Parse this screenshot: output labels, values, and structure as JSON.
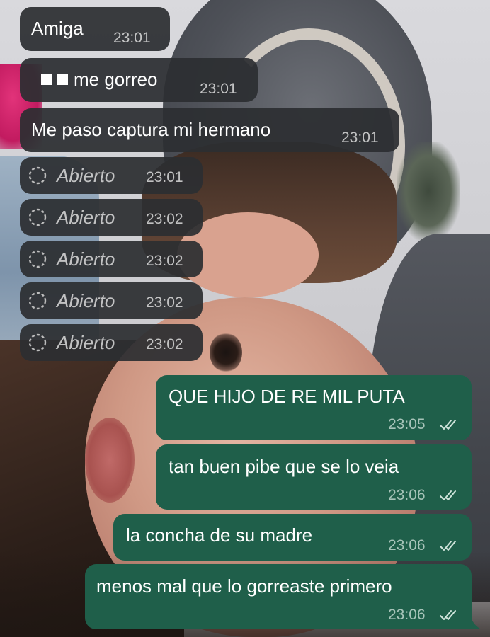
{
  "messages": [
    {
      "direction": "incoming",
      "text": "Amiga",
      "time": "23:01"
    },
    {
      "direction": "incoming",
      "prefix_icon": "two-white-squares-emoji",
      "text": "me gorreo",
      "time": "23:01"
    },
    {
      "direction": "incoming",
      "text": "Me paso captura mi hermano",
      "time": "23:01"
    },
    {
      "direction": "incoming",
      "type": "view-once-opened",
      "icon": "view-once-icon",
      "text": "Abierto",
      "time": "23:01"
    },
    {
      "direction": "incoming",
      "type": "view-once-opened",
      "icon": "view-once-icon",
      "text": "Abierto",
      "time": "23:02"
    },
    {
      "direction": "incoming",
      "type": "view-once-opened",
      "icon": "view-once-icon",
      "text": "Abierto",
      "time": "23:02"
    },
    {
      "direction": "incoming",
      "type": "view-once-opened",
      "icon": "view-once-icon",
      "text": "Abierto",
      "time": "23:02"
    },
    {
      "direction": "incoming",
      "type": "view-once-opened",
      "icon": "view-once-icon",
      "text": "Abierto",
      "time": "23:02"
    },
    {
      "direction": "outgoing",
      "text": "QUE HIJO DE RE MIL PUTA",
      "time": "23:05",
      "status": "read-double-check"
    },
    {
      "direction": "outgoing",
      "text": "tan buen pibe que se lo veia",
      "time": "23:06",
      "status": "read-double-check"
    },
    {
      "direction": "outgoing",
      "text": "la concha de su madre",
      "time": "23:06",
      "status": "read-double-check"
    },
    {
      "direction": "outgoing",
      "text": "menos mal que lo gorreaste primero",
      "time": "23:06",
      "status": "read-double-check"
    }
  ],
  "colors": {
    "incoming_bubble": "#2c2e31",
    "outgoing_bubble": "#1f5f4a",
    "text": "#ffffff",
    "timestamp": "#cfcfcf"
  }
}
